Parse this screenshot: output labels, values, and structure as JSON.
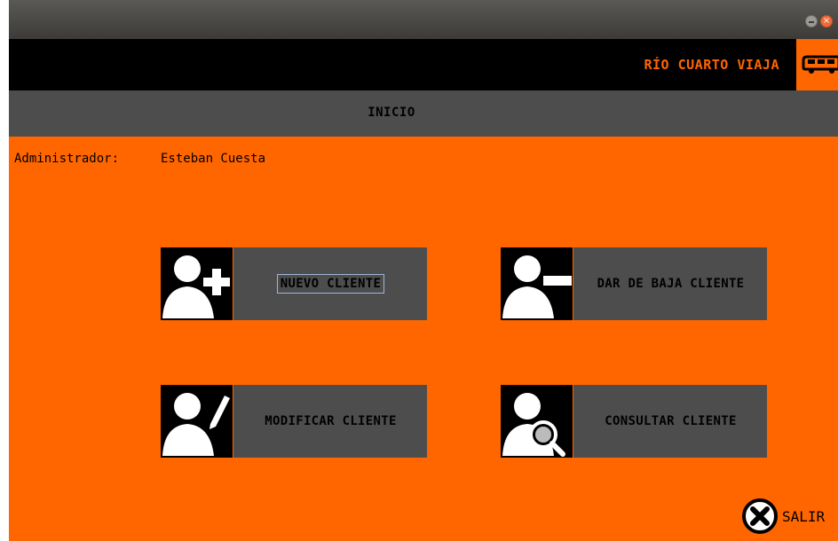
{
  "window": {
    "close_glyph": "×"
  },
  "header": {
    "brand": "RÍO CUARTO VIAJA",
    "brand_color": "#ff6600",
    "brand_icon": "bus-icon"
  },
  "subheader": {
    "title": "INICIO"
  },
  "admin": {
    "label": "Administrador:",
    "name": "Esteban Cuesta"
  },
  "actions": {
    "nuevo": {
      "label": "NUEVO CLIENTE",
      "icon": "user-add-icon"
    },
    "baja": {
      "label": "DAR DE BAJA CLIENTE",
      "icon": "user-remove-icon"
    },
    "modificar": {
      "label": "MODIFICAR CLIENTE",
      "icon": "user-edit-icon"
    },
    "consultar": {
      "label": "CONSULTAR CLIENTE",
      "icon": "user-search-icon"
    }
  },
  "exit": {
    "label": "SALIR",
    "icon": "close-circle-icon"
  },
  "colors": {
    "background": "#ff6600",
    "panel": "#4d4d4d",
    "header": "#000000"
  }
}
